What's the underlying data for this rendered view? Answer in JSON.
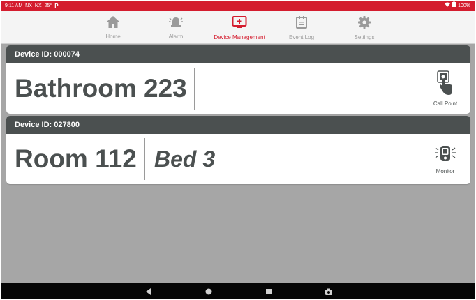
{
  "status_bar": {
    "time": "9:11 AM",
    "indicators": [
      "NX",
      "NX",
      "25°"
    ],
    "app_glyph": "P",
    "battery": "100%"
  },
  "nav": {
    "items": [
      {
        "label": "Home",
        "icon": "home-icon",
        "active": false
      },
      {
        "label": "Alarm",
        "icon": "alarm-bell-icon",
        "active": false
      },
      {
        "label": "Device Management",
        "icon": "device-management-icon",
        "active": true
      },
      {
        "label": "Event Log",
        "icon": "event-log-icon",
        "active": false
      },
      {
        "label": "Settings",
        "icon": "gear-icon",
        "active": false
      }
    ]
  },
  "devices": [
    {
      "header": "Device ID: 000074",
      "location": "Bathroom 223",
      "sub": "",
      "type_label": "Call Point",
      "type_icon": "call-point-icon"
    },
    {
      "header": "Device ID: 027800",
      "location": "Room 112",
      "sub": "Bed 3",
      "type_label": "Monitor",
      "type_icon": "monitor-icon"
    }
  ],
  "system_bar": {
    "buttons": [
      "back-icon",
      "home-circle-icon",
      "recents-icon",
      "screenshot-icon"
    ]
  },
  "colors": {
    "accent": "#d41c2e",
    "header_bg": "#4b5050",
    "page_bg": "#a6a6a6",
    "inactive": "#9a9a9a"
  }
}
